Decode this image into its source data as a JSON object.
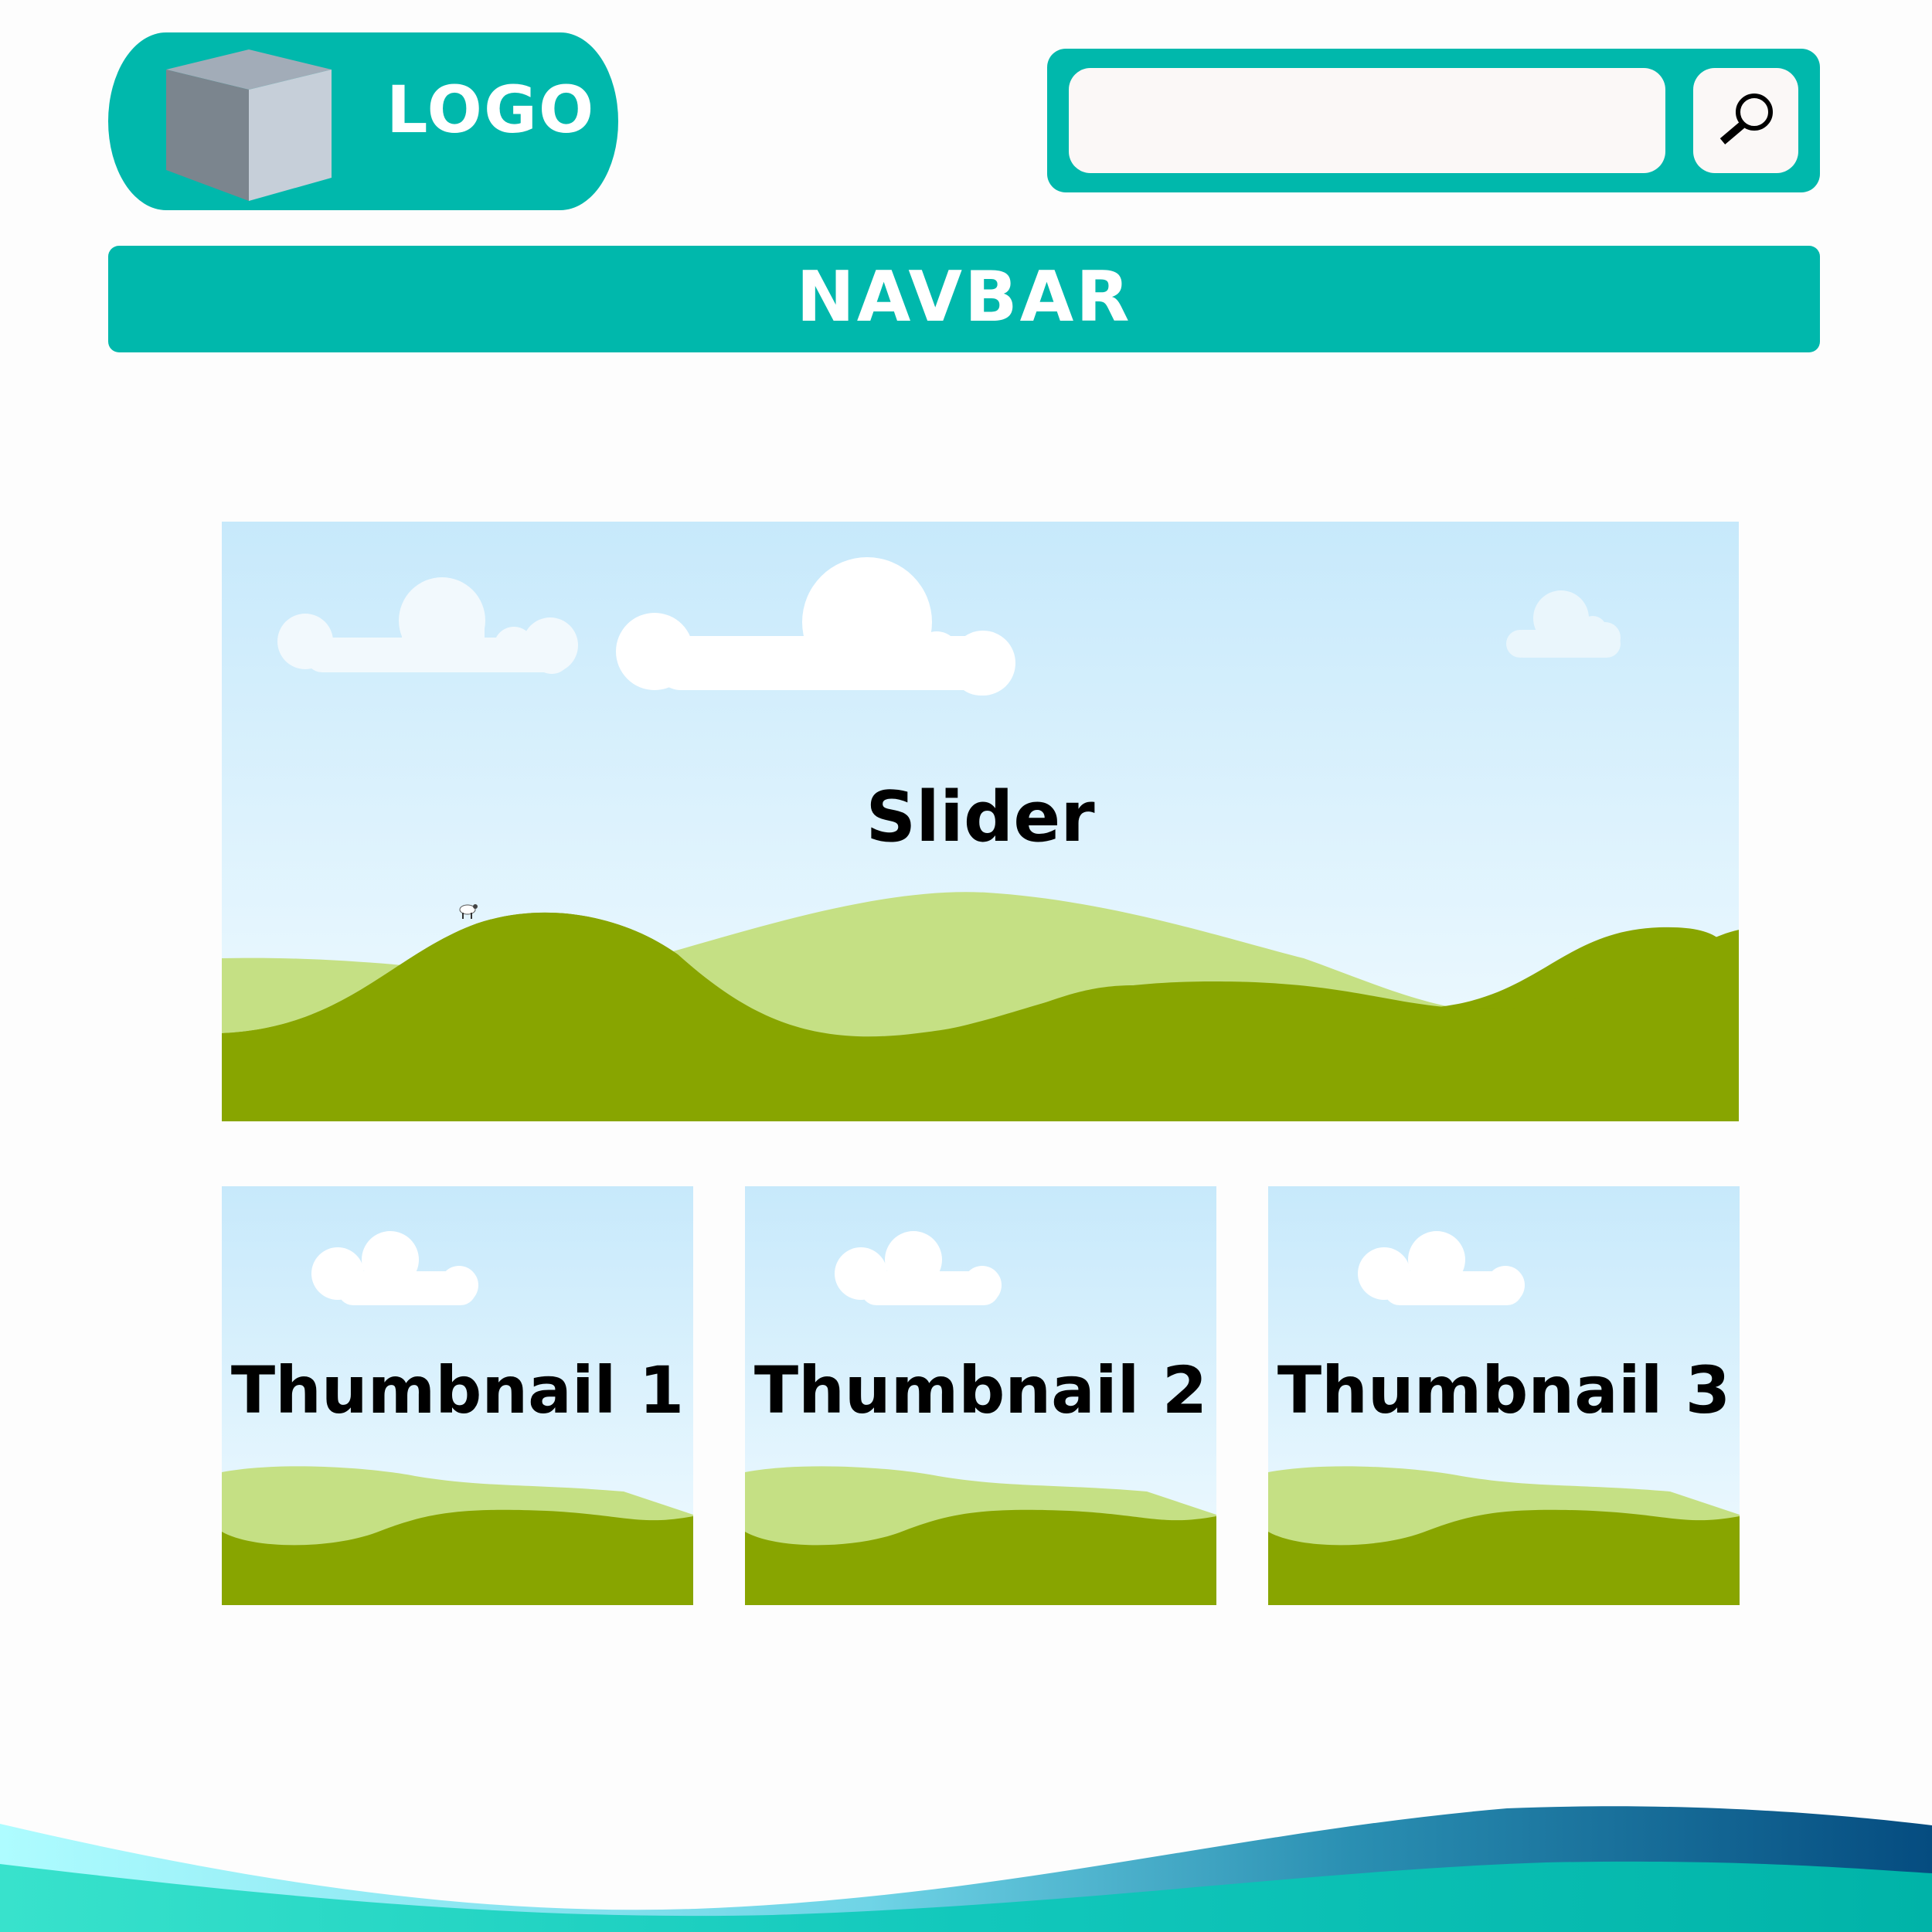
{
  "header": {
    "logo": {
      "label": "LOGO",
      "icon": "cube-icon"
    },
    "search": {
      "value": "",
      "placeholder": "",
      "icon": "magnifier-icon"
    }
  },
  "navbar": {
    "label": "NAVBAR"
  },
  "slider": {
    "label": "Slider"
  },
  "thumbnails": [
    {
      "label": "Thumbnail 1"
    },
    {
      "label": "Thumbnail 2"
    },
    {
      "label": "Thumbnail 3"
    }
  ],
  "colors": {
    "accent": "#00b8ac",
    "sky_top": "#c7e9fb",
    "sky_bottom": "#f0faff",
    "hill_light": "#c5e084",
    "hill_dark": "#88a500",
    "input_bg": "#fbf8f7"
  }
}
